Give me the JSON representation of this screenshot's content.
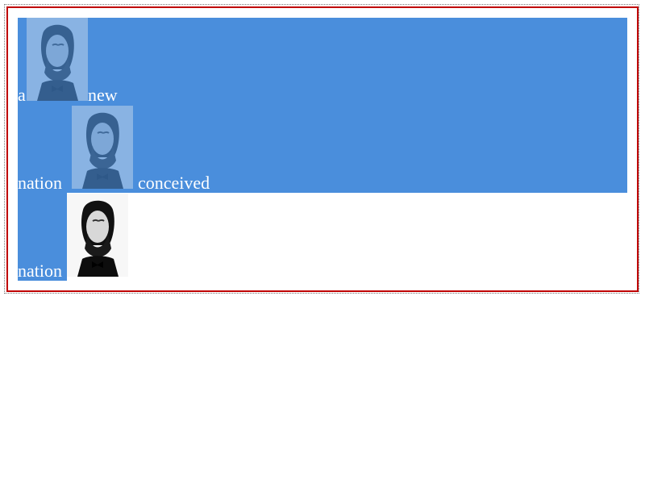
{
  "selection_color": "#4a8edc",
  "frame_color": "#c00000",
  "lines": [
    {
      "words": [
        "a",
        "new"
      ],
      "image_alt": "portrait"
    },
    {
      "words": [
        "nation",
        "conceived"
      ],
      "image_alt": "portrait"
    },
    {
      "words": [
        "nation"
      ],
      "image_alt": "portrait"
    }
  ],
  "icons": {
    "portrait": "lincoln-portrait-icon"
  }
}
